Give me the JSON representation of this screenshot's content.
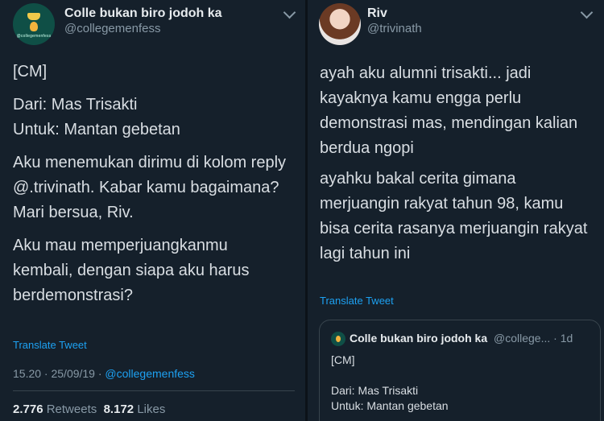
{
  "left": {
    "name": "Colle bukan biro jodoh ka",
    "handle": "@collegemenfess",
    "avatar_text": "@collegemenfess",
    "lines": [
      "[CM]",
      "Dari: Mas Trisakti",
      "Untuk: Mantan gebetan",
      "Aku menemukan dirimu di kolom reply",
      "@.trivinath. Kabar kamu bagaimana?",
      "Mari bersua, Riv.",
      "Aku mau memperjuangkanmu",
      "kembali, dengan siapa aku harus",
      "berdemonstrasi?"
    ],
    "translate": "Translate Tweet",
    "time": "15.20 · 25/09/19 · ",
    "via": "@collegemenfess",
    "retweets_count": "2.776",
    "retweets_label": "Retweets",
    "likes_count": "8.172",
    "likes_label": "Likes"
  },
  "right": {
    "name": "Riv",
    "handle": "@trivinath",
    "lines": [
      "ayah aku alumni trisakti... jadi",
      "kayaknya kamu engga perlu",
      "demonstrasi mas, mendingan kalian",
      "berdua ngopi",
      "ayahku bakal cerita gimana",
      "merjuangin rakyat tahun 98, kamu",
      "bisa cerita rasanya merjuangin rakyat",
      "lagi tahun ini"
    ],
    "translate": "Translate Tweet",
    "quote": {
      "name": "Colle bukan biro jodoh ka",
      "handle": "@college... · 1d",
      "lines": [
        "[CM]",
        "Dari: Mas Trisakti",
        "Untuk: Mantan gebetan"
      ]
    }
  },
  "colors": {
    "background": "#15202b",
    "link": "#1da1f2",
    "muted": "#8899a6"
  },
  "icons": [
    "chevron-down-icon",
    "avatar"
  ]
}
